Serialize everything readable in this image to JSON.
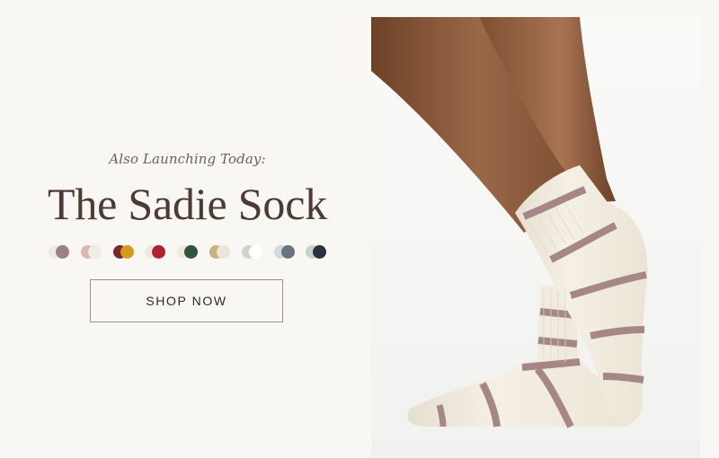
{
  "hero": {
    "eyebrow": "Also Launching Today:",
    "title": "The Sadie Sock",
    "button_label": "SHOP NOW"
  },
  "swatches": [
    {
      "name": "swatch-mauve",
      "colors": [
        "#efe9e0",
        "#9b8287"
      ]
    },
    {
      "name": "swatch-blush",
      "colors": [
        "#dbb8b1",
        "#f1ede5"
      ]
    },
    {
      "name": "swatch-wine-mustard",
      "colors": [
        "#7c2630",
        "#d49a1c"
      ]
    },
    {
      "name": "swatch-red",
      "colors": [
        "#efe9e0",
        "#b2212f"
      ]
    },
    {
      "name": "swatch-green",
      "colors": [
        "#efe9e0",
        "#305440"
      ]
    },
    {
      "name": "swatch-sand",
      "colors": [
        "#c8b183",
        "#ede6d8"
      ]
    },
    {
      "name": "swatch-grey-white",
      "colors": [
        "#cfd3cf",
        "#ffffff"
      ]
    },
    {
      "name": "swatch-slate",
      "colors": [
        "#d7dadb",
        "#66757f"
      ]
    },
    {
      "name": "swatch-navy",
      "colors": [
        "#c8d3cd",
        "#2a3240"
      ]
    }
  ],
  "photo": {
    "icon": "sock-product-photo",
    "sock_color": "#f3ede0",
    "stripe_color": "#a68687",
    "skin_color": "#8a5a3e"
  }
}
